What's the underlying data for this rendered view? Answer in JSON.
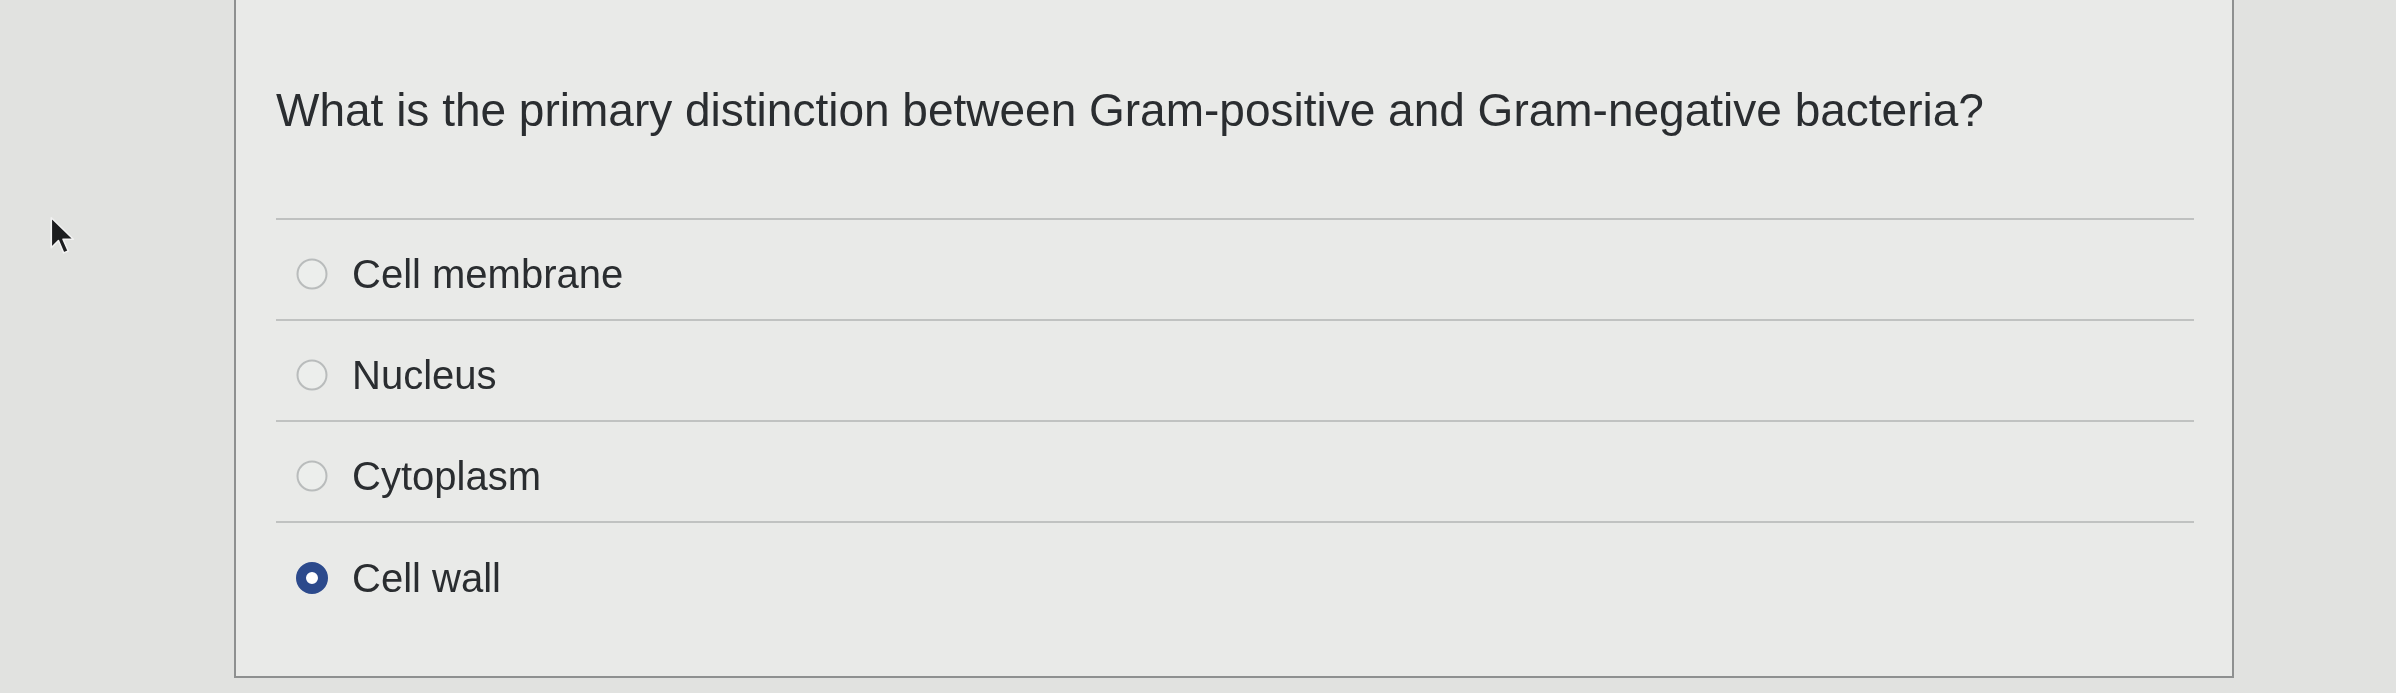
{
  "question": {
    "text": "What is the primary distinction between Gram-positive and Gram-negative bacteria?"
  },
  "options": [
    {
      "label": "Cell membrane",
      "selected": false
    },
    {
      "label": "Nucleus",
      "selected": false
    },
    {
      "label": "Cytoplasm",
      "selected": false
    },
    {
      "label": "Cell wall",
      "selected": true
    }
  ]
}
